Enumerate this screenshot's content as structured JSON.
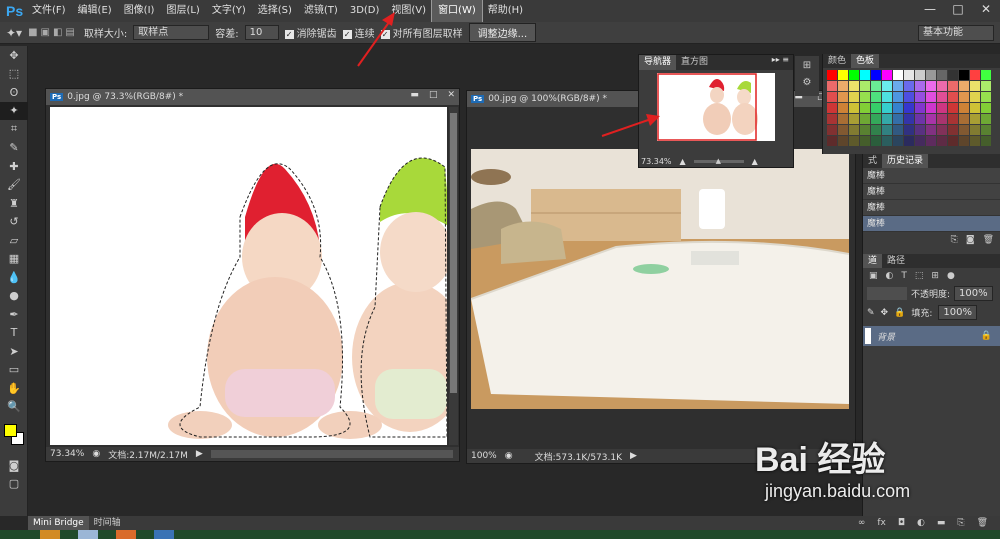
{
  "app": {
    "logo": "Ps"
  },
  "menu": [
    "文件(F)",
    "编辑(E)",
    "图像(I)",
    "图层(L)",
    "文字(Y)",
    "选择(S)",
    "滤镜(T)",
    "3D(D)",
    "视图(V)",
    "窗口(W)",
    "帮助(H)"
  ],
  "window_controls": {
    "minimize": "—",
    "maximize": "□",
    "close": "✕"
  },
  "options": {
    "sample_size_label": "取样大小:",
    "sample_size_value": "取样点",
    "tolerance_label": "容差:",
    "tolerance_value": "10",
    "antialias_label": "消除锯齿",
    "contiguous_label": "连续",
    "all_layers_label": "对所有图层取样",
    "refine_edge_button": "调整边缘...",
    "workspace": "基本功能"
  },
  "documents": [
    {
      "title": "0.jpg @ 73.3%(RGB/8#) *",
      "zoom": "73.34%",
      "doc_size": "文档:2.17M/2.17M"
    },
    {
      "title": "00.jpg @ 100%(RGB/8#) *",
      "zoom": "100%",
      "doc_size": "文档:573.1K/573.1K"
    }
  ],
  "navigator": {
    "tabs": [
      "导航器",
      "直方图"
    ],
    "zoom": "73.34%"
  },
  "swatches": {
    "tabs": [
      "颜色",
      "色板"
    ]
  },
  "history": {
    "tabs": [
      "式",
      "历史记录"
    ],
    "items": [
      "魔棒",
      "魔棒",
      "魔棒",
      "魔棒"
    ]
  },
  "layers": {
    "tabs": [
      "道",
      "路径"
    ],
    "opacity_label": "不透明度:",
    "opacity_value": "100%",
    "fill_label": "填充:",
    "fill_value": "100%",
    "layer_name": "背景"
  },
  "bottom_panel": {
    "tabs": [
      "Mini Bridge",
      "时间轴"
    ]
  },
  "watermark": {
    "brand": "Bai 经验",
    "url": "jingyan.baidu.com"
  },
  "colors": {
    "accent": "#1e6bb5",
    "annotation": "#e02020",
    "foreground": "#ffff00",
    "background": "#ffffff"
  }
}
